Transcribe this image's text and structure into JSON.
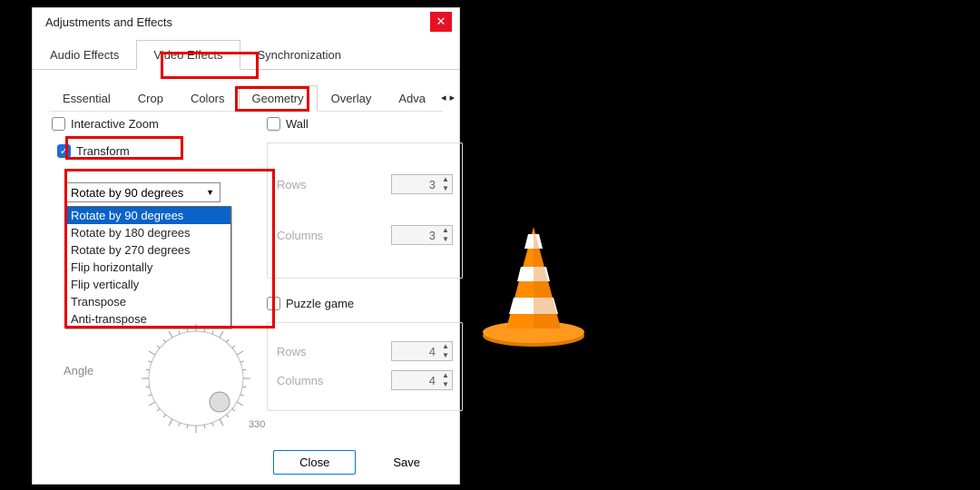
{
  "dialog": {
    "title": "Adjustments and Effects"
  },
  "tabs1": {
    "audio": "Audio Effects",
    "video": "Video Effects",
    "sync": "Synchronization",
    "active": "video"
  },
  "tabs2": {
    "t0": "Essential",
    "t1": "Crop",
    "t2": "Colors",
    "t3": "Geometry",
    "t4": "Overlay",
    "t5": "Adva",
    "active": "t3"
  },
  "geom": {
    "interactive_zoom": "Interactive Zoom",
    "transform": "Transform",
    "transform_checked": true,
    "combo_value": "Rotate by 90 degrees",
    "options": {
      "o0": "Rotate by 90 degrees",
      "o1": "Rotate by 180 degrees",
      "o2": "Rotate by 270 degrees",
      "o3": "Flip horizontally",
      "o4": "Flip vertically",
      "o5": "Transpose",
      "o6": "Anti-transpose"
    },
    "angle_label": "Angle",
    "angle_tick": "330"
  },
  "wall": {
    "label": "Wall",
    "rows_label": "Rows",
    "rows_value": "3",
    "cols_label": "Columns",
    "cols_value": "3"
  },
  "puzzle": {
    "label": "Puzzle game",
    "rows_label": "Rows",
    "rows_value": "4",
    "cols_label": "Columns",
    "cols_value": "4"
  },
  "footer": {
    "close": "Close",
    "save": "Save"
  },
  "highlight_color": "#e40000"
}
